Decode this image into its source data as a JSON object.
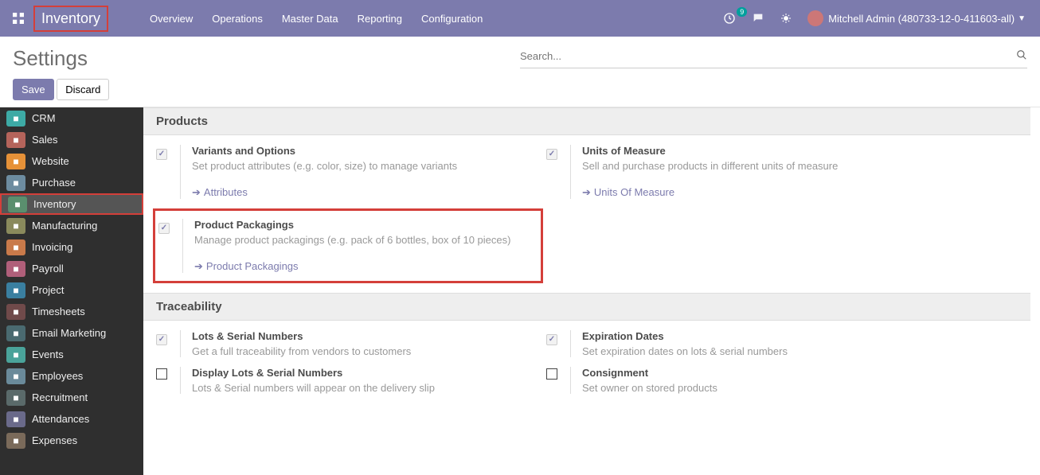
{
  "navbar": {
    "brand": "Inventory",
    "links": [
      "Overview",
      "Operations",
      "Master Data",
      "Reporting",
      "Configuration"
    ],
    "badge_count": "9",
    "user_name": "Mitchell Admin (480733-12-0-411603-all)"
  },
  "control": {
    "title": "Settings",
    "save": "Save",
    "discard": "Discard",
    "search_placeholder": "Search..."
  },
  "sidebar": {
    "items": [
      {
        "label": "CRM",
        "color": "#3daaa5"
      },
      {
        "label": "Sales",
        "color": "#b5645b"
      },
      {
        "label": "Website",
        "color": "#e69138"
      },
      {
        "label": "Purchase",
        "color": "#6d8ca0"
      },
      {
        "label": "Inventory",
        "color": "#5a8f6e",
        "active": true
      },
      {
        "label": "Manufacturing",
        "color": "#8a8a5c"
      },
      {
        "label": "Invoicing",
        "color": "#c97a4a"
      },
      {
        "label": "Payroll",
        "color": "#b05f7a"
      },
      {
        "label": "Project",
        "color": "#3a7fa0"
      },
      {
        "label": "Timesheets",
        "color": "#704a4a"
      },
      {
        "label": "Email Marketing",
        "color": "#4a6a70"
      },
      {
        "label": "Events",
        "color": "#4aa39a"
      },
      {
        "label": "Employees",
        "color": "#6a8a9a"
      },
      {
        "label": "Recruitment",
        "color": "#5a6a6a"
      },
      {
        "label": "Attendances",
        "color": "#6a6a8a"
      },
      {
        "label": "Expenses",
        "color": "#7a6a5a"
      }
    ]
  },
  "sections": {
    "products": {
      "header": "Products",
      "variants": {
        "title": "Variants and Options",
        "desc": "Set product attributes (e.g. color, size) to manage variants",
        "link": "Attributes"
      },
      "uom": {
        "title": "Units of Measure",
        "desc": "Sell and purchase products in different units of measure",
        "link": "Units Of Measure"
      },
      "packagings": {
        "title": "Product Packagings",
        "desc": "Manage product packagings (e.g. pack of 6 bottles, box of 10 pieces)",
        "link": "Product Packagings"
      }
    },
    "traceability": {
      "header": "Traceability",
      "lots": {
        "title": "Lots & Serial Numbers",
        "desc": "Get a full traceability from vendors to customers"
      },
      "expiration": {
        "title": "Expiration Dates",
        "desc": "Set expiration dates on lots & serial numbers"
      },
      "display_lots": {
        "title": "Display Lots & Serial Numbers",
        "desc": "Lots & Serial numbers will appear on the delivery slip"
      },
      "consignment": {
        "title": "Consignment",
        "desc": "Set owner on stored products"
      }
    }
  }
}
